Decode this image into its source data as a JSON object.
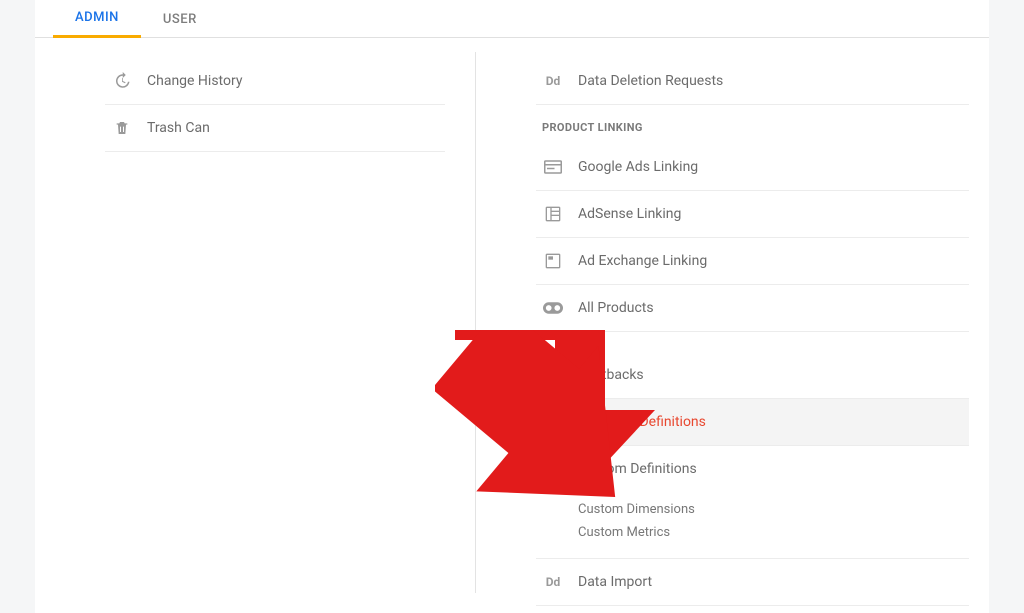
{
  "tabs": {
    "admin": "ADMIN",
    "user": "USER"
  },
  "left": {
    "change_history": "Change History",
    "trash_can": "Trash Can"
  },
  "right": {
    "data_deletion": "Data Deletion Requests",
    "section_product_linking": "PRODUCT LINKING",
    "google_ads": "Google Ads Linking",
    "adsense": "AdSense Linking",
    "ad_exchange": "Ad Exchange Linking",
    "all_products": "All Products",
    "postbacks": "Postbacks",
    "audience_definitions": "Audience Definitions",
    "custom_definitions": "Custom Definitions",
    "custom_dimensions": "Custom Dimensions",
    "custom_metrics": "Custom Metrics",
    "data_import": "Data Import"
  },
  "colors": {
    "accent_blue": "#1a73e8",
    "tab_underline": "#f9ab00",
    "highlight_red": "#e8472f",
    "arrow_red": "#e21b1b"
  }
}
